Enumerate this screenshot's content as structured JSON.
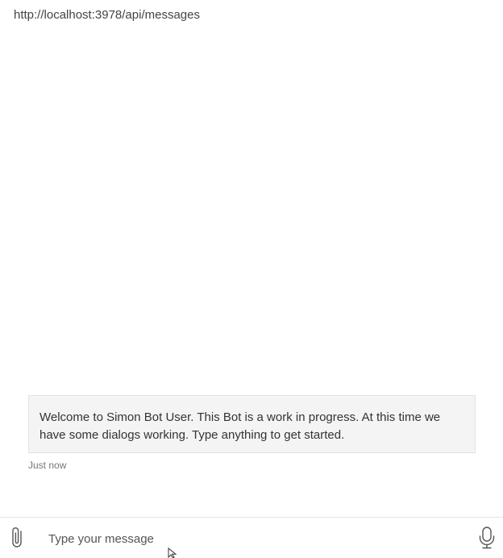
{
  "header": {
    "endpoint_url": "http://localhost:3978/api/messages"
  },
  "transcript": {
    "messages": [
      {
        "from": "bot",
        "text": "Welcome to Simon Bot User. This Bot is a work in progress. At this time we have some dialogs working. Type anything to get started.",
        "timestamp": "Just now"
      }
    ]
  },
  "composer": {
    "placeholder": "Type your message",
    "value": "",
    "attach_icon": "paperclip-icon",
    "mic_icon": "microphone-icon"
  },
  "colors": {
    "bubble_bg": "#f4f4f4",
    "text": "#333333",
    "muted": "#767676"
  }
}
